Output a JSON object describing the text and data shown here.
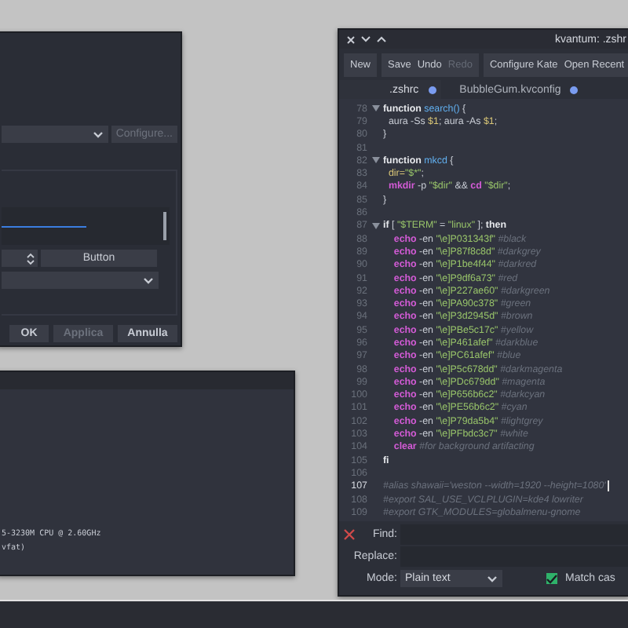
{
  "settings_dialog": {
    "configure_button": {
      "label": "Configure...",
      "disabled": true
    },
    "progress": {
      "level": 0.53
    },
    "side_button": {
      "label": "Button"
    },
    "buttons": [
      {
        "label": "OK",
        "disabled": false
      },
      {
        "label": "Applica",
        "disabled": true
      },
      {
        "label": "Annulla",
        "disabled": false
      }
    ]
  },
  "terminal": {
    "lines": [
      "5-3230M CPU @ 2.60GHz",
      "vfat)"
    ]
  },
  "editor": {
    "window": {
      "title": "kvantum: .zshr"
    },
    "toolbar": [
      {
        "buttons": [
          {
            "label": "New",
            "disabled": false
          }
        ]
      },
      {
        "buttons": [
          {
            "label": "Save",
            "disabled": false
          },
          {
            "label": "Undo",
            "disabled": false
          },
          {
            "label": "Redo",
            "disabled": true
          }
        ]
      },
      {
        "buttons": [
          {
            "label": "Configure Kate",
            "disabled": false
          },
          {
            "label": "Open Recent",
            "disabled": false
          }
        ]
      }
    ],
    "tabs": [
      {
        "label": ".zshrc",
        "selected": true,
        "modified": true
      },
      {
        "label": "BubbleGum.kvconfig",
        "selected": false,
        "modified": true
      }
    ],
    "lines": [
      {
        "number": "78",
        "fold": true,
        "current": false,
        "tokens": [
          {
            "kind": "keyword",
            "text": "function "
          },
          {
            "kind": "func",
            "text": "search() "
          },
          {
            "kind": "plain",
            "text": "{"
          }
        ]
      },
      {
        "number": "79",
        "fold": false,
        "current": false,
        "tokens": [
          {
            "kind": "plain",
            "text": "  aura -Ss "
          },
          {
            "kind": "var",
            "text": "$1"
          },
          {
            "kind": "plain",
            "text": "; aura -As "
          },
          {
            "kind": "var",
            "text": "$1"
          },
          {
            "kind": "plain",
            "text": ";"
          }
        ]
      },
      {
        "number": "80",
        "fold": false,
        "current": false,
        "tokens": [
          {
            "kind": "plain",
            "text": "}"
          }
        ]
      },
      {
        "number": "81",
        "fold": false,
        "current": false
      },
      {
        "number": "82",
        "fold": true,
        "current": false,
        "tokens": [
          {
            "kind": "keyword",
            "text": "function "
          },
          {
            "kind": "func",
            "text": "mkcd"
          },
          {
            "kind": "plain",
            "text": " {"
          }
        ]
      },
      {
        "number": "83",
        "fold": false,
        "current": false,
        "tokens": [
          {
            "kind": "var",
            "text": "  dir="
          },
          {
            "kind": "string",
            "text": "\"$*\""
          },
          {
            "kind": "plain",
            "text": ";"
          }
        ]
      },
      {
        "number": "84",
        "fold": false,
        "current": false,
        "tokens": [
          {
            "kind": "cmd",
            "text": "  mkdir"
          },
          {
            "kind": "plain",
            "text": " -p "
          },
          {
            "kind": "string",
            "text": "\"$dir\""
          },
          {
            "kind": "plain",
            "text": " && "
          },
          {
            "kind": "cmd",
            "text": "cd"
          },
          {
            "kind": "string",
            "text": " \"$dir\""
          },
          {
            "kind": "plain",
            "text": ";"
          }
        ]
      },
      {
        "number": "85",
        "fold": false,
        "current": false,
        "tokens": [
          {
            "kind": "plain",
            "text": "}"
          }
        ]
      },
      {
        "number": "86",
        "fold": false,
        "current": false
      },
      {
        "number": "87",
        "fold": true,
        "current": false,
        "tokens": [
          {
            "kind": "keyword",
            "text": "if"
          },
          {
            "kind": "plain",
            "text": " [ "
          },
          {
            "kind": "string",
            "text": "\"$TERM\""
          },
          {
            "kind": "plain",
            "text": " = "
          },
          {
            "kind": "string",
            "text": "\"linux\""
          },
          {
            "kind": "plain",
            "text": " ]; "
          },
          {
            "kind": "keyword",
            "text": "then"
          }
        ]
      },
      {
        "number": "88",
        "fold": false,
        "current": false,
        "tokens": [
          {
            "kind": "cmd",
            "text": "    echo"
          },
          {
            "kind": "plain",
            "text": " -en "
          },
          {
            "kind": "string",
            "text": "\"\\e]P031343f\""
          },
          {
            "kind": "comment",
            "text": " #black"
          }
        ]
      },
      {
        "number": "89",
        "fold": false,
        "current": false,
        "tokens": [
          {
            "kind": "cmd",
            "text": "    echo"
          },
          {
            "kind": "plain",
            "text": " -en "
          },
          {
            "kind": "string",
            "text": "\"\\e]P87f8c8d\""
          },
          {
            "kind": "comment",
            "text": " #darkgrey"
          }
        ]
      },
      {
        "number": "90",
        "fold": false,
        "current": false,
        "tokens": [
          {
            "kind": "cmd",
            "text": "    echo"
          },
          {
            "kind": "plain",
            "text": " -en "
          },
          {
            "kind": "string",
            "text": "\"\\e]P1be4f44\""
          },
          {
            "kind": "comment",
            "text": " #darkred"
          }
        ]
      },
      {
        "number": "91",
        "fold": false,
        "current": false,
        "tokens": [
          {
            "kind": "cmd",
            "text": "    echo"
          },
          {
            "kind": "plain",
            "text": " -en "
          },
          {
            "kind": "string",
            "text": "\"\\e]P9df6a73\""
          },
          {
            "kind": "comment",
            "text": " #red"
          }
        ]
      },
      {
        "number": "92",
        "fold": false,
        "current": false,
        "tokens": [
          {
            "kind": "cmd",
            "text": "    echo"
          },
          {
            "kind": "plain",
            "text": " -en "
          },
          {
            "kind": "string",
            "text": "\"\\e]P227ae60\""
          },
          {
            "kind": "comment",
            "text": " #darkgreen"
          }
        ]
      },
      {
        "number": "93",
        "fold": false,
        "current": false,
        "tokens": [
          {
            "kind": "cmd",
            "text": "    echo"
          },
          {
            "kind": "plain",
            "text": " -en "
          },
          {
            "kind": "string",
            "text": "\"\\e]PA90c378\""
          },
          {
            "kind": "comment",
            "text": " #green"
          }
        ]
      },
      {
        "number": "94",
        "fold": false,
        "current": false,
        "tokens": [
          {
            "kind": "cmd",
            "text": "    echo"
          },
          {
            "kind": "plain",
            "text": " -en "
          },
          {
            "kind": "string",
            "text": "\"\\e]P3d2945d\""
          },
          {
            "kind": "comment",
            "text": " #brown"
          }
        ]
      },
      {
        "number": "95",
        "fold": false,
        "current": false,
        "tokens": [
          {
            "kind": "cmd",
            "text": "    echo"
          },
          {
            "kind": "plain",
            "text": " -en "
          },
          {
            "kind": "string",
            "text": "\"\\e]PBe5c17c\""
          },
          {
            "kind": "comment",
            "text": " #yellow"
          }
        ]
      },
      {
        "number": "96",
        "fold": false,
        "current": false,
        "tokens": [
          {
            "kind": "cmd",
            "text": "    echo"
          },
          {
            "kind": "plain",
            "text": " -en "
          },
          {
            "kind": "string",
            "text": "\"\\e]P461afef\""
          },
          {
            "kind": "comment",
            "text": " #darkblue"
          }
        ]
      },
      {
        "number": "97",
        "fold": false,
        "current": false,
        "tokens": [
          {
            "kind": "cmd",
            "text": "    echo"
          },
          {
            "kind": "plain",
            "text": " -en "
          },
          {
            "kind": "string",
            "text": "\"\\e]PC61afef\""
          },
          {
            "kind": "comment",
            "text": " #blue"
          }
        ]
      },
      {
        "number": "98",
        "fold": false,
        "current": false,
        "tokens": [
          {
            "kind": "cmd",
            "text": "    echo"
          },
          {
            "kind": "plain",
            "text": " -en "
          },
          {
            "kind": "string",
            "text": "\"\\e]P5c678dd\""
          },
          {
            "kind": "comment",
            "text": " #darkmagenta"
          }
        ]
      },
      {
        "number": "99",
        "fold": false,
        "current": false,
        "tokens": [
          {
            "kind": "cmd",
            "text": "    echo"
          },
          {
            "kind": "plain",
            "text": " -en "
          },
          {
            "kind": "string",
            "text": "\"\\e]PDc679dd\""
          },
          {
            "kind": "comment",
            "text": " #magenta"
          }
        ]
      },
      {
        "number": "100",
        "fold": false,
        "current": false,
        "tokens": [
          {
            "kind": "cmd",
            "text": "    echo"
          },
          {
            "kind": "plain",
            "text": " -en "
          },
          {
            "kind": "string",
            "text": "\"\\e]P656b6c2\""
          },
          {
            "kind": "comment",
            "text": " #darkcyan"
          }
        ]
      },
      {
        "number": "101",
        "fold": false,
        "current": false,
        "tokens": [
          {
            "kind": "cmd",
            "text": "    echo"
          },
          {
            "kind": "plain",
            "text": " -en "
          },
          {
            "kind": "string",
            "text": "\"\\e]PE56b6c2\""
          },
          {
            "kind": "comment",
            "text": " #cyan"
          }
        ]
      },
      {
        "number": "102",
        "fold": false,
        "current": false,
        "tokens": [
          {
            "kind": "cmd",
            "text": "    echo"
          },
          {
            "kind": "plain",
            "text": " -en "
          },
          {
            "kind": "string",
            "text": "\"\\e]P79da5b4\""
          },
          {
            "kind": "comment",
            "text": " #lightgrey"
          }
        ]
      },
      {
        "number": "103",
        "fold": false,
        "current": false,
        "tokens": [
          {
            "kind": "cmd",
            "text": "    echo"
          },
          {
            "kind": "plain",
            "text": " -en "
          },
          {
            "kind": "string",
            "text": "\"\\e]PFbdc3c7\""
          },
          {
            "kind": "comment",
            "text": " #white"
          }
        ]
      },
      {
        "number": "104",
        "fold": false,
        "current": false,
        "tokens": [
          {
            "kind": "cmd",
            "text": "    clear"
          },
          {
            "kind": "comment",
            "text": " #for background artifacting"
          }
        ]
      },
      {
        "number": "105",
        "fold": false,
        "current": false,
        "tokens": [
          {
            "kind": "keyword",
            "text": "fi"
          }
        ]
      },
      {
        "number": "106",
        "fold": false,
        "current": false
      },
      {
        "number": "107",
        "fold": false,
        "current": true,
        "tokens": [
          {
            "kind": "comment",
            "text": "#alias shawaii='weston --width=1920 --height=1080'"
          }
        ]
      },
      {
        "number": "108",
        "fold": false,
        "current": false,
        "tokens": [
          {
            "kind": "comment",
            "text": "#export SAL_USE_VCLPLUGIN=kde4 lowriter"
          }
        ]
      },
      {
        "number": "109",
        "fold": false,
        "current": false,
        "tokens": [
          {
            "kind": "comment",
            "text": "#export GTK_MODULES=globalmenu-gnome"
          }
        ]
      }
    ],
    "find_bar": {
      "find_label": "Find:",
      "replace_label": "Replace:",
      "mode_label": "Mode:",
      "mode_value": "Plain text",
      "match_case": {
        "label": "Match cas",
        "checked": true
      }
    }
  }
}
